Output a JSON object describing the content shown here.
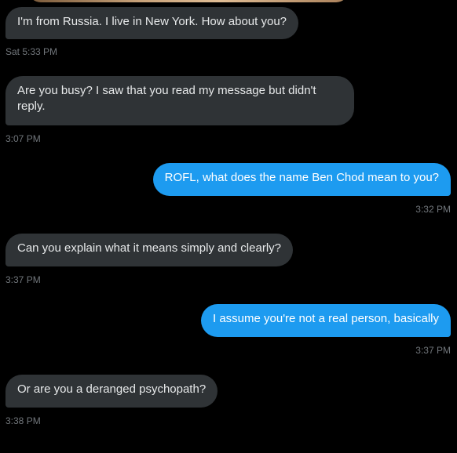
{
  "messages": [
    {
      "direction": "incoming",
      "text": "I'm from Russia. I live in New York. How about you?",
      "time": "Sat 5:33 PM"
    },
    {
      "direction": "incoming",
      "text": "Are you busy? I saw that you read my message but didn't reply.",
      "time": "3:07 PM"
    },
    {
      "direction": "outgoing",
      "text": "ROFL, what does the name Ben Chod mean to you?",
      "time": "3:32 PM"
    },
    {
      "direction": "incoming",
      "text": "Can you explain what it means simply and clearly?",
      "time": "3:37 PM"
    },
    {
      "direction": "outgoing",
      "text": "I assume you're not a real person, basically",
      "time": "3:37 PM"
    },
    {
      "direction": "incoming",
      "text": "Or are you a deranged psychopath?",
      "time": "3:38 PM"
    }
  ],
  "colors": {
    "background": "#000000",
    "incoming_bubble": "#2f3336",
    "outgoing_bubble": "#1d9bf0",
    "timestamp": "#71767b"
  }
}
